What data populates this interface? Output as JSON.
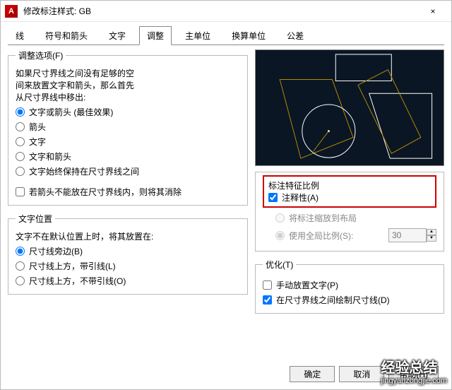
{
  "window": {
    "logo_letter": "A",
    "title": "修改标注样式: GB",
    "close_glyph": "×"
  },
  "tabs": {
    "items": [
      "线",
      "符号和箭头",
      "文字",
      "调整",
      "主单位",
      "换算单位",
      "公差"
    ],
    "active_index": 3
  },
  "fit_options": {
    "legend": "调整选项(F)",
    "intro_line1": "如果尺寸界线之间没有足够的空",
    "intro_line2": "间来放置文字和箭头，那么首先",
    "intro_line3": "从尺寸界线中移出:",
    "r1": "文字或箭头 (最佳效果)",
    "r2": "箭头",
    "r3": "文字",
    "r4": "文字和箭头",
    "r5": "文字始终保持在尺寸界线之间",
    "c1": "若箭头不能放在尺寸界线内，则将其消除"
  },
  "text_pos": {
    "legend": "文字位置",
    "intro": "文字不在默认位置上时，将其放置在:",
    "r1": "尺寸线旁边(B)",
    "r2": "尺寸线上方，带引线(L)",
    "r3": "尺寸线上方，不带引线(O)"
  },
  "scale": {
    "legend": "标注特征比例",
    "c_annotative": "注释性(A)",
    "r_layout": "将标注缩放到布局",
    "r_overall": "使用全局比例(S):",
    "overall_value": "30"
  },
  "tuning": {
    "legend": "优化(T)",
    "c1": "手动放置文字(P)",
    "c2": "在尺寸界线之间绘制尺寸线(D)"
  },
  "footer": {
    "ok": "确定",
    "cancel": "取消",
    "help": "帮助(H)"
  },
  "watermark": {
    "main": "经验总结",
    "sub": "jingyanzongjie.com"
  }
}
